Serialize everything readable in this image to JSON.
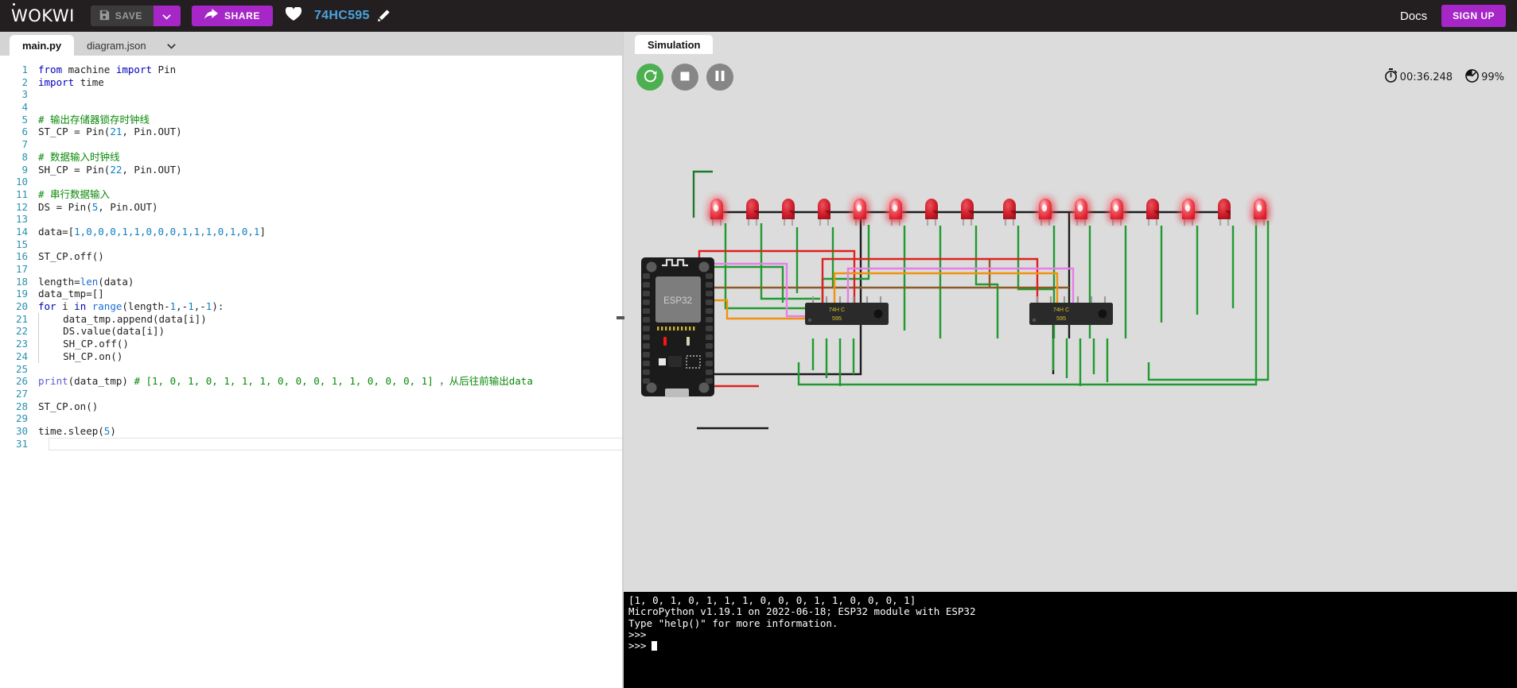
{
  "topbar": {
    "logo": "WOKWI",
    "save_label": "SAVE",
    "save_icon": "floppy-disk-icon",
    "caret_icon": "chevron-down-icon",
    "share_label": "SHARE",
    "share_icon": "share-arrow-icon",
    "heart_icon": "heart-icon",
    "project_title": "74HC595",
    "edit_icon": "pencil-icon",
    "docs_label": "Docs",
    "signup_label": "SIGN UP",
    "accent_color": "#a626c7",
    "bg_color": "#231f20",
    "title_color": "#4aa3df"
  },
  "editor": {
    "tabs": [
      {
        "label": "main.py",
        "active": true
      },
      {
        "label": "diagram.json",
        "active": false
      }
    ],
    "dropdown_icon": "chevron-down-icon",
    "active_line": 31,
    "total_lines": 31,
    "code": [
      {
        "n": 1,
        "tokens": [
          {
            "t": "from ",
            "c": "kw"
          },
          {
            "t": "machine ",
            "c": "ct"
          },
          {
            "t": "import ",
            "c": "kw"
          },
          {
            "t": "Pin",
            "c": "ct"
          }
        ]
      },
      {
        "n": 2,
        "tokens": [
          {
            "t": "import ",
            "c": "kw"
          },
          {
            "t": "time",
            "c": "ct"
          }
        ]
      },
      {
        "n": 3,
        "tokens": []
      },
      {
        "n": 4,
        "tokens": []
      },
      {
        "n": 5,
        "tokens": [
          {
            "t": "# 输出存储器锁存时钟线",
            "c": "cmt"
          }
        ]
      },
      {
        "n": 6,
        "tokens": [
          {
            "t": "ST_CP = Pin(",
            "c": "ct"
          },
          {
            "t": "21",
            "c": "num"
          },
          {
            "t": ", Pin.OUT)",
            "c": "ct"
          }
        ]
      },
      {
        "n": 7,
        "tokens": []
      },
      {
        "n": 8,
        "tokens": [
          {
            "t": "# 数据输入时钟线",
            "c": "cmt"
          }
        ]
      },
      {
        "n": 9,
        "tokens": [
          {
            "t": "SH_CP = Pin(",
            "c": "ct"
          },
          {
            "t": "22",
            "c": "num"
          },
          {
            "t": ", Pin.OUT)",
            "c": "ct"
          }
        ]
      },
      {
        "n": 10,
        "tokens": []
      },
      {
        "n": 11,
        "tokens": [
          {
            "t": "# 串行数据输入",
            "c": "cmt"
          }
        ]
      },
      {
        "n": 12,
        "tokens": [
          {
            "t": "DS = Pin(",
            "c": "ct"
          },
          {
            "t": "5",
            "c": "num"
          },
          {
            "t": ", Pin.OUT)",
            "c": "ct"
          }
        ]
      },
      {
        "n": 13,
        "tokens": []
      },
      {
        "n": 14,
        "tokens": [
          {
            "t": "data=[",
            "c": "ct"
          },
          {
            "t": "1,0,0,0,1,1,0,0,0,1,1,1,0,1,0,1",
            "c": "num"
          },
          {
            "t": "]",
            "c": "ct"
          }
        ]
      },
      {
        "n": 15,
        "tokens": []
      },
      {
        "n": 16,
        "tokens": [
          {
            "t": "ST_CP.off()",
            "c": "ct"
          }
        ]
      },
      {
        "n": 17,
        "tokens": []
      },
      {
        "n": 18,
        "tokens": [
          {
            "t": "length=",
            "c": "ct"
          },
          {
            "t": "len",
            "c": "fn"
          },
          {
            "t": "(data)",
            "c": "ct"
          }
        ]
      },
      {
        "n": 19,
        "tokens": [
          {
            "t": "data_tmp=[]",
            "c": "ct"
          }
        ]
      },
      {
        "n": 20,
        "tokens": [
          {
            "t": "for ",
            "c": "kw"
          },
          {
            "t": "i ",
            "c": "ct"
          },
          {
            "t": "in ",
            "c": "kw"
          },
          {
            "t": "range",
            "c": "fn"
          },
          {
            "t": "(length-",
            "c": "ct"
          },
          {
            "t": "1",
            "c": "num"
          },
          {
            "t": ",-",
            "c": "ct"
          },
          {
            "t": "1",
            "c": "num"
          },
          {
            "t": ",-",
            "c": "ct"
          },
          {
            "t": "1",
            "c": "num"
          },
          {
            "t": "):",
            "c": "ct"
          }
        ]
      },
      {
        "n": 21,
        "indent": 1,
        "tokens": [
          {
            "t": "    data_tmp.append(data[i])",
            "c": "ct"
          }
        ]
      },
      {
        "n": 22,
        "indent": 1,
        "tokens": [
          {
            "t": "    DS.value(data[i])",
            "c": "ct"
          }
        ]
      },
      {
        "n": 23,
        "indent": 1,
        "tokens": [
          {
            "t": "    SH_CP.off()",
            "c": "ct"
          }
        ]
      },
      {
        "n": 24,
        "indent": 1,
        "tokens": [
          {
            "t": "    SH_CP.on()",
            "c": "ct"
          }
        ]
      },
      {
        "n": 25,
        "tokens": []
      },
      {
        "n": 26,
        "tokens": [
          {
            "t": "print",
            "c": "kw2"
          },
          {
            "t": "(data_tmp) ",
            "c": "ct"
          },
          {
            "t": "# [1, 0, 1, 0, 1, 1, 1, 0, 0, 0, 1, 1, 0, 0, 0, 1] ，从后往前输出data",
            "c": "cmt"
          }
        ]
      },
      {
        "n": 27,
        "tokens": []
      },
      {
        "n": 28,
        "tokens": [
          {
            "t": "ST_CP.on()",
            "c": "ct"
          }
        ]
      },
      {
        "n": 29,
        "tokens": []
      },
      {
        "n": 30,
        "tokens": [
          {
            "t": "time.sleep(",
            "c": "ct"
          },
          {
            "t": "5",
            "c": "num"
          },
          {
            "t": ")",
            "c": "ct"
          }
        ]
      },
      {
        "n": 31,
        "tokens": []
      }
    ]
  },
  "simulation": {
    "tab_label": "Simulation",
    "restart_icon": "restart-icon",
    "stop_icon": "stop-icon",
    "pause_icon": "pause-icon",
    "timer_icon": "stopwatch-icon",
    "timer_value": "00:36.248",
    "perf_icon": "gauge-icon",
    "perf_value": "99%",
    "restart_color": "#4caf50",
    "idle_color": "#868686",
    "board_label": "ESP32",
    "chip_label_line1": "74H C",
    "chip_label_line2": "595",
    "chips": [
      "74HC595",
      "74HC595"
    ],
    "led_color": "#e8323c",
    "led_states": [
      1,
      0,
      0,
      0,
      1,
      1,
      0,
      0,
      0,
      1,
      1,
      1,
      0,
      1,
      0,
      1
    ]
  },
  "terminal": {
    "lines": [
      "[1, 0, 1, 0, 1, 1, 1, 0, 0, 0, 1, 1, 0, 0, 0, 1]",
      "MicroPython v1.19.1 on 2022-06-18; ESP32 module with ESP32",
      "Type \"help()\" for more information.",
      ">>>"
    ],
    "prompt": ">>>"
  }
}
